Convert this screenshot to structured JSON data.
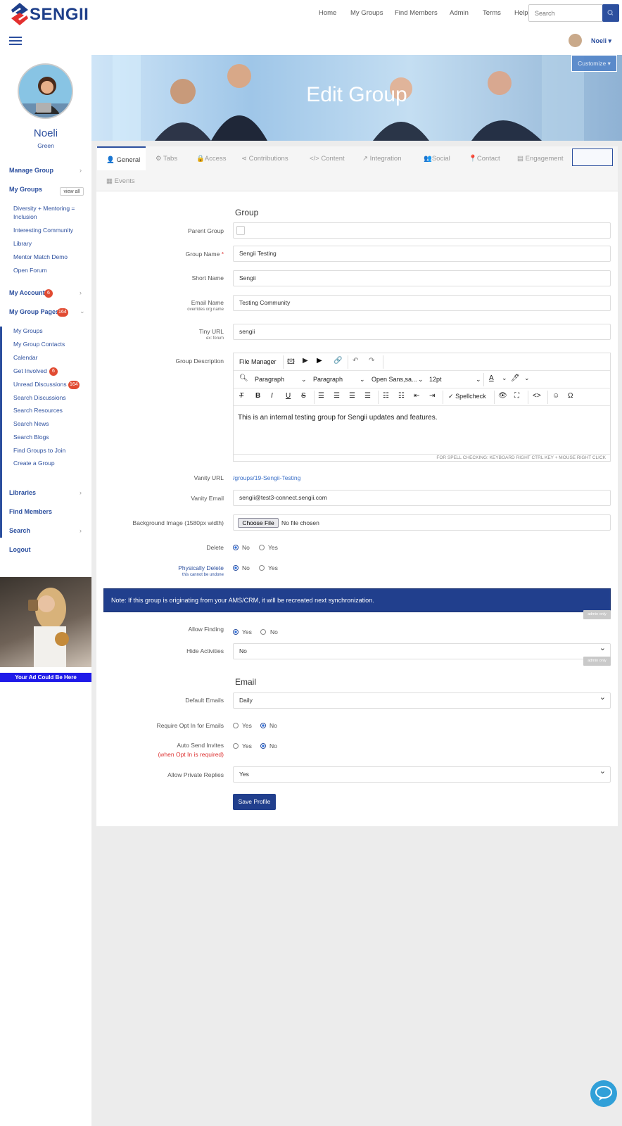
{
  "brand": {
    "name": "SENGII"
  },
  "topnav": [
    "Home",
    "My Groups",
    "Find Members",
    "Admin",
    "Terms",
    "Help"
  ],
  "search": {
    "placeholder": "Search"
  },
  "user": {
    "name": "Noeli"
  },
  "profile": {
    "name": "Noeli",
    "subtitle": "Green"
  },
  "sidebar": {
    "manage_group": "Manage Group",
    "my_groups": "My Groups",
    "view_all": "view all",
    "group_links": [
      "Diversity + Mentoring =",
      "Inclusion",
      "Interesting Community",
      "Library",
      "Mentor Match Demo",
      "Open Forum"
    ],
    "my_account": "My Account",
    "my_account_badge": "6",
    "my_group_pages": "My Group Pages",
    "my_group_pages_badge": "164",
    "page_links": [
      "My Groups",
      "My Group Contacts",
      "Calendar",
      "Get Involved",
      "Unread Discussions",
      "Search Discussions",
      "Search Resources",
      "Search News",
      "Search Blogs",
      "Find Groups to Join",
      "Create a Group"
    ],
    "get_involved_badge": "6",
    "unread_badge": "164",
    "libraries": "Libraries",
    "find_members": "Find Members",
    "search": "Search",
    "logout": "Logout",
    "ad_text": "Your Ad Could Be Here"
  },
  "banner": {
    "title": "Edit Group",
    "customize": "Customize"
  },
  "tabs": [
    "General",
    "Tabs",
    "Access",
    "Contributions",
    "Content",
    "Integration",
    "Social",
    "Contact",
    "Engagement",
    "Events"
  ],
  "form": {
    "group_section": "Group",
    "parent_group_label": "Parent Group",
    "group_name_label": "Group Name",
    "group_name_value": "Sengii Testing",
    "short_name_label": "Short Name",
    "short_name_value": "Sengii",
    "email_name_label": "Email Name",
    "email_name_sub": "overrides org name",
    "email_name_value": "Testing Community",
    "tiny_url_label": "Tiny URL",
    "tiny_url_sub": "ex: forum",
    "tiny_url_value": "sengii",
    "description_label": "Group Description",
    "editor": {
      "file_manager": "File Manager",
      "paragraph1": "Paragraph",
      "paragraph2": "Paragraph",
      "font": "Open Sans,sa...",
      "size": "12pt",
      "spellcheck": "Spellcheck",
      "content": "This is an internal testing group for Sengii updates and features.",
      "footer": "FOR SPELL CHECKING: KEYBOARD RIGHT CTRL KEY + MOUSE RIGHT CLICK"
    },
    "vanity_url_label": "Vanity URL",
    "vanity_url_value": "/groups/19-Sengii-Testing",
    "vanity_email_label": "Vanity Email",
    "vanity_email_value": "sengii@test3-connect.sengii.com",
    "bg_image_label": "Background Image (1580px width)",
    "choose_file": "Choose File",
    "no_file": "No file chosen",
    "delete_label": "Delete",
    "phys_delete_label": "Physically Delete",
    "phys_delete_sub": "this cannot be undone",
    "no": "No",
    "yes": "Yes",
    "note": "Note: If this group is originating from your AMS/CRM, it will be recreated next synchronization.",
    "admin_only": "admin only",
    "allow_finding_label": "Allow Finding",
    "hide_activities_label": "Hide Activities",
    "hide_activities_value": "No",
    "email_section": "Email",
    "default_emails_label": "Default Emails",
    "default_emails_value": "Daily",
    "require_optin_label": "Require Opt In for Emails",
    "auto_send_label": "Auto Send Invites",
    "auto_send_sub": "(when Opt In is required)",
    "private_replies_label": "Allow Private Replies",
    "private_replies_value": "Yes",
    "save": "Save Profile"
  },
  "colors": {
    "brand": "#2c4f9e",
    "note_bg": "#213f8d",
    "badge": "#e14b32",
    "ad_bar": "#1f1ae8"
  }
}
